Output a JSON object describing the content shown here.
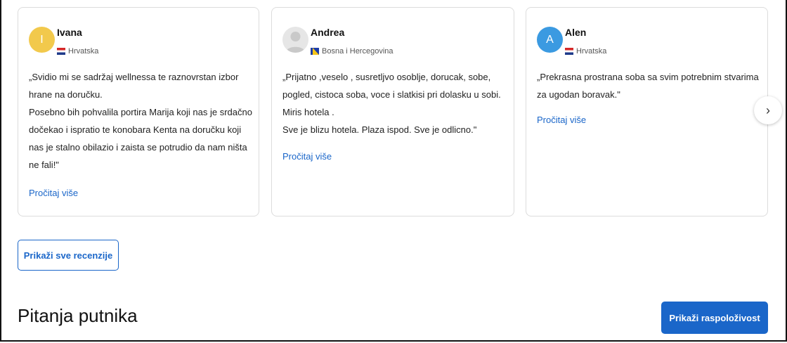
{
  "reviews": [
    {
      "initial": "I",
      "avatar_color": "#f2c94c",
      "name": "Ivana",
      "country": "Hrvatska",
      "text_lines": [
        "„Svidio mi se sadržaj wellnessa te raznovrstan izbor hrane na doručku.",
        "Posebno bih pohvalila portira Marija koji nas je srdačno dočekao i ispratio te konobara Kenta na doručku koji nas je stalno obilazio i zaista se potrudio da nam ništa ne fali!\""
      ],
      "read_more": "Pročitaj više"
    },
    {
      "initial": "",
      "avatar_color": "#e6e6e6",
      "name": "Andrea",
      "country": "Bosna i Hercegovina",
      "text_lines": [
        "„Prijatno ,veselo , susretljvo osoblje, dorucak, sobe, pogled, cistoca soba, voce i slatkisi pri dolasku u sobi. Miris hotela .",
        "Sve je blizu hotela. Plaza ispod. Sve je odlicno.\""
      ],
      "read_more": "Pročitaj više"
    },
    {
      "initial": "A",
      "avatar_color": "#3b9ae1",
      "name": "Alen",
      "country": "Hrvatska",
      "text_lines": [
        "„Prekrasna prostrana soba sa svim potrebnim stvarima za ugodan boravak.\""
      ],
      "read_more": "Pročitaj više"
    }
  ],
  "carousel": {
    "next_icon": "chevron-right-icon",
    "next_glyph": "›"
  },
  "buttons": {
    "all_reviews": "Prikaži sve recenzije",
    "availability": "Prikaži raspoloživost"
  },
  "section": {
    "title": "Pitanja putnika"
  },
  "colors": {
    "accent": "#1a66c9"
  }
}
